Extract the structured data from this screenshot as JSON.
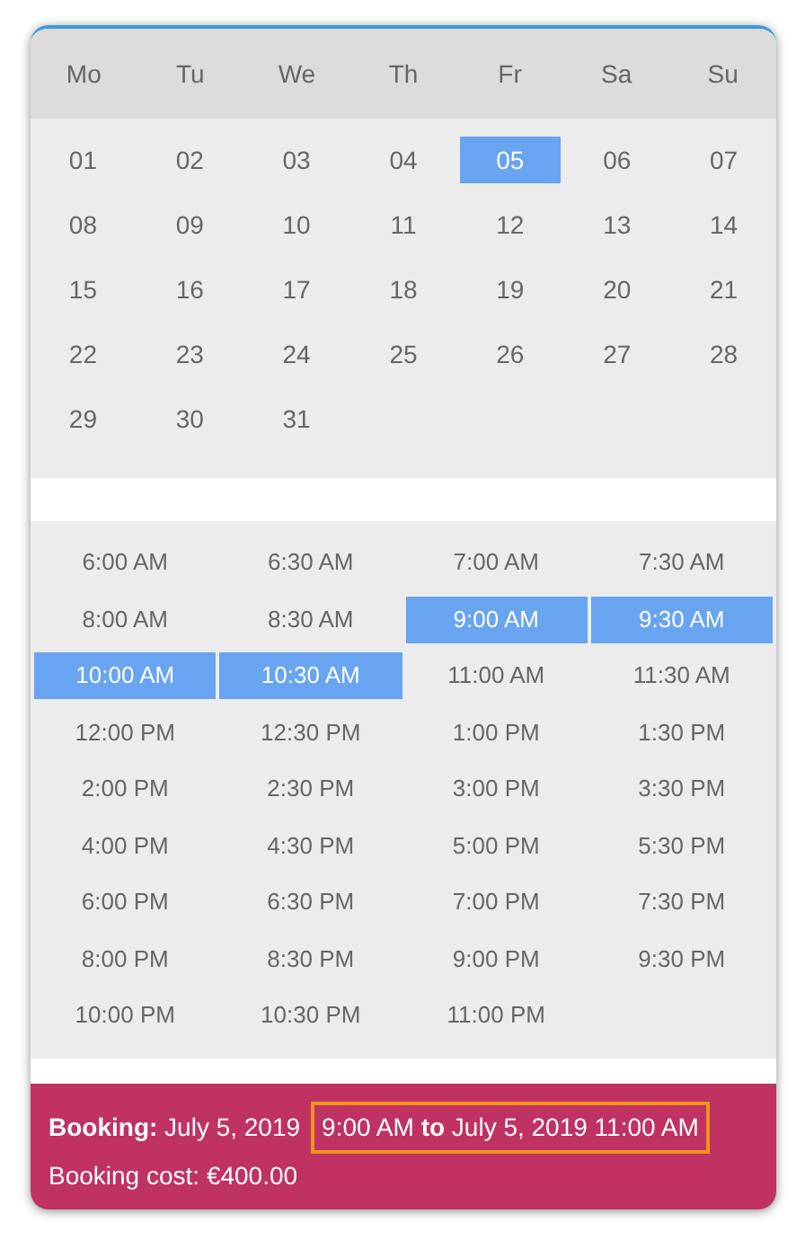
{
  "weekdays": [
    "Mo",
    "Tu",
    "We",
    "Th",
    "Fr",
    "Sa",
    "Su"
  ],
  "days": [
    {
      "label": "01",
      "selected": false
    },
    {
      "label": "02",
      "selected": false
    },
    {
      "label": "03",
      "selected": false
    },
    {
      "label": "04",
      "selected": false
    },
    {
      "label": "05",
      "selected": true
    },
    {
      "label": "06",
      "selected": false
    },
    {
      "label": "07",
      "selected": false
    },
    {
      "label": "08",
      "selected": false
    },
    {
      "label": "09",
      "selected": false
    },
    {
      "label": "10",
      "selected": false
    },
    {
      "label": "11",
      "selected": false
    },
    {
      "label": "12",
      "selected": false
    },
    {
      "label": "13",
      "selected": false
    },
    {
      "label": "14",
      "selected": false
    },
    {
      "label": "15",
      "selected": false
    },
    {
      "label": "16",
      "selected": false
    },
    {
      "label": "17",
      "selected": false
    },
    {
      "label": "18",
      "selected": false
    },
    {
      "label": "19",
      "selected": false
    },
    {
      "label": "20",
      "selected": false
    },
    {
      "label": "21",
      "selected": false
    },
    {
      "label": "22",
      "selected": false
    },
    {
      "label": "23",
      "selected": false
    },
    {
      "label": "24",
      "selected": false
    },
    {
      "label": "25",
      "selected": false
    },
    {
      "label": "26",
      "selected": false
    },
    {
      "label": "27",
      "selected": false
    },
    {
      "label": "28",
      "selected": false
    },
    {
      "label": "29",
      "selected": false
    },
    {
      "label": "30",
      "selected": false
    },
    {
      "label": "31",
      "selected": false
    }
  ],
  "times": [
    {
      "label": "6:00 AM",
      "selected": false
    },
    {
      "label": "6:30 AM",
      "selected": false
    },
    {
      "label": "7:00 AM",
      "selected": false
    },
    {
      "label": "7:30 AM",
      "selected": false
    },
    {
      "label": "8:00 AM",
      "selected": false
    },
    {
      "label": "8:30 AM",
      "selected": false
    },
    {
      "label": "9:00 AM",
      "selected": true
    },
    {
      "label": "9:30 AM",
      "selected": true
    },
    {
      "label": "10:00 AM",
      "selected": true
    },
    {
      "label": "10:30 AM",
      "selected": true
    },
    {
      "label": "11:00 AM",
      "selected": false
    },
    {
      "label": "11:30 AM",
      "selected": false
    },
    {
      "label": "12:00 PM",
      "selected": false
    },
    {
      "label": "12:30 PM",
      "selected": false
    },
    {
      "label": "1:00 PM",
      "selected": false
    },
    {
      "label": "1:30 PM",
      "selected": false
    },
    {
      "label": "2:00 PM",
      "selected": false
    },
    {
      "label": "2:30 PM",
      "selected": false
    },
    {
      "label": "3:00 PM",
      "selected": false
    },
    {
      "label": "3:30 PM",
      "selected": false
    },
    {
      "label": "4:00 PM",
      "selected": false
    },
    {
      "label": "4:30 PM",
      "selected": false
    },
    {
      "label": "5:00 PM",
      "selected": false
    },
    {
      "label": "5:30 PM",
      "selected": false
    },
    {
      "label": "6:00 PM",
      "selected": false
    },
    {
      "label": "6:30 PM",
      "selected": false
    },
    {
      "label": "7:00 PM",
      "selected": false
    },
    {
      "label": "7:30 PM",
      "selected": false
    },
    {
      "label": "8:00 PM",
      "selected": false
    },
    {
      "label": "8:30 PM",
      "selected": false
    },
    {
      "label": "9:00 PM",
      "selected": false
    },
    {
      "label": "9:30 PM",
      "selected": false
    },
    {
      "label": "10:00 PM",
      "selected": false
    },
    {
      "label": "10:30 PM",
      "selected": false
    },
    {
      "label": "11:00 PM",
      "selected": false
    }
  ],
  "booking": {
    "summary": "**Booking:** July 5, 2019",
    "range": "9:00 AM **to** July 5, 2019 11:00 AM",
    "cost": "Booking cost: €400.00"
  }
}
